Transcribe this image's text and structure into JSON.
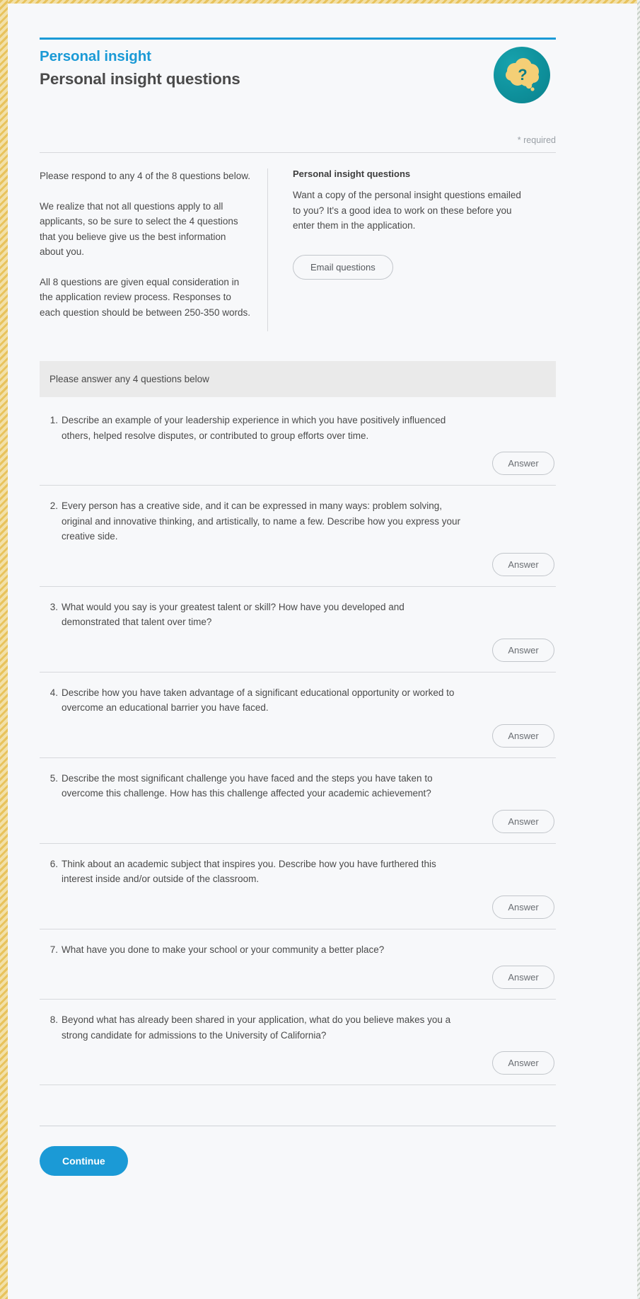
{
  "header": {
    "eyebrow": "Personal insight",
    "title": "Personal insight questions",
    "badge_icon": "thought-bubble-question-icon",
    "required_note": "* required",
    "accent_color": "#1b9ad6",
    "badge_color": "#0e8f9a",
    "badge_bubble_color": "#f4cf76"
  },
  "intro": {
    "left_paragraphs": [
      "Please respond to any 4 of the 8 questions below.",
      "We realize that not all questions apply to all applicants, so be sure to select the 4 questions that you believe give us the best information about you.",
      "All 8 questions are given equal consideration in the application review process. Responses to each question should be between 250-350 words."
    ],
    "right_heading": "Personal insight questions",
    "right_body": "Want a copy of the personal insight questions emailed to you? It's a good idea to work on these before you enter them in the application.",
    "email_button_label": "Email questions"
  },
  "section": {
    "bar_label": "Please answer any 4 questions below"
  },
  "questions": [
    {
      "number": "1.",
      "text": "Describe an example of your leadership experience in which you have positively influenced others, helped resolve disputes, or contributed to group efforts over time.",
      "answer_label": "Answer"
    },
    {
      "number": "2.",
      "text": "Every person has a creative side, and it can be expressed in many ways: problem solving, original and innovative thinking, and artistically, to name a few. Describe how you express your creative side.",
      "answer_label": "Answer"
    },
    {
      "number": "3.",
      "text": "What would you say is your greatest talent or skill? How have you developed and demonstrated that talent over time?",
      "answer_label": "Answer"
    },
    {
      "number": "4.",
      "text": "Describe how you have taken advantage of a significant educational opportunity or worked to overcome an educational barrier you have faced.",
      "answer_label": "Answer"
    },
    {
      "number": "5.",
      "text": "Describe the most significant challenge you have faced and the steps you have taken to overcome this challenge. How has this challenge affected your academic achievement?",
      "answer_label": "Answer"
    },
    {
      "number": "6.",
      "text": "Think about an academic subject that inspires you. Describe how you have furthered this interest inside and/or outside of the classroom.",
      "answer_label": "Answer"
    },
    {
      "number": "7.",
      "text": "What have you done to make your school or your community a better place?",
      "answer_label": "Answer"
    },
    {
      "number": "8.",
      "text": "Beyond what has already been shared in your application, what do you believe makes you a strong candidate for admissions to the University of California?",
      "answer_label": "Answer"
    }
  ],
  "footer": {
    "continue_label": "Continue"
  }
}
